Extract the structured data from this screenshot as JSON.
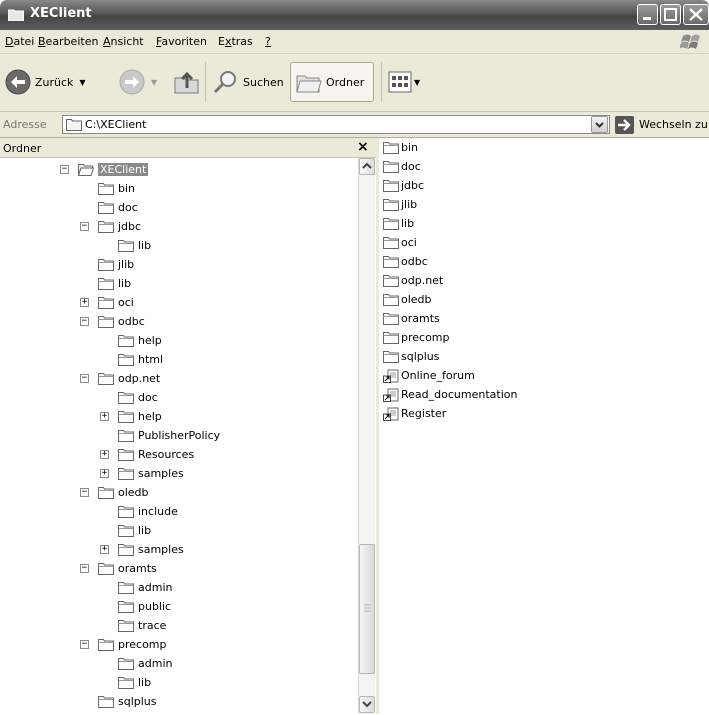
{
  "window": {
    "title": "XEClient"
  },
  "menu": [
    {
      "pre": "",
      "u": "D",
      "post": "atei",
      "name": "menu-datei"
    },
    {
      "pre": "",
      "u": "B",
      "post": "earbeiten",
      "name": "menu-bearbeiten"
    },
    {
      "pre": "",
      "u": "A",
      "post": "nsicht",
      "name": "menu-ansicht"
    },
    {
      "pre": "",
      "u": "F",
      "post": "avoriten",
      "name": "menu-favoriten"
    },
    {
      "pre": "E",
      "u": "x",
      "post": "tras",
      "name": "menu-extras"
    },
    {
      "pre": "",
      "u": "?",
      "post": "",
      "name": "menu-help"
    }
  ],
  "toolbar": {
    "back_label": "Zurück",
    "search_label": "Suchen",
    "folders_label": "Ordner"
  },
  "address": {
    "label": "Adresse",
    "path": "C:\\XEClient",
    "go_label": "Wechseln zu"
  },
  "folder_pane": {
    "title": "Ordner",
    "close": "×"
  },
  "tree": [
    {
      "label": "XEClient",
      "depth": 0,
      "expander": "minus",
      "selected": true
    },
    {
      "label": "bin",
      "depth": 1,
      "expander": "none"
    },
    {
      "label": "doc",
      "depth": 1,
      "expander": "none"
    },
    {
      "label": "jdbc",
      "depth": 1,
      "expander": "minus"
    },
    {
      "label": "lib",
      "depth": 2,
      "expander": "none"
    },
    {
      "label": "jlib",
      "depth": 1,
      "expander": "none"
    },
    {
      "label": "lib",
      "depth": 1,
      "expander": "none"
    },
    {
      "label": "oci",
      "depth": 1,
      "expander": "plus"
    },
    {
      "label": "odbc",
      "depth": 1,
      "expander": "minus"
    },
    {
      "label": "help",
      "depth": 2,
      "expander": "none"
    },
    {
      "label": "html",
      "depth": 2,
      "expander": "none"
    },
    {
      "label": "odp.net",
      "depth": 1,
      "expander": "minus"
    },
    {
      "label": "doc",
      "depth": 2,
      "expander": "none"
    },
    {
      "label": "help",
      "depth": 2,
      "expander": "plus"
    },
    {
      "label": "PublisherPolicy",
      "depth": 2,
      "expander": "none"
    },
    {
      "label": "Resources",
      "depth": 2,
      "expander": "plus"
    },
    {
      "label": "samples",
      "depth": 2,
      "expander": "plus"
    },
    {
      "label": "oledb",
      "depth": 1,
      "expander": "minus"
    },
    {
      "label": "include",
      "depth": 2,
      "expander": "none"
    },
    {
      "label": "lib",
      "depth": 2,
      "expander": "none"
    },
    {
      "label": "samples",
      "depth": 2,
      "expander": "plus"
    },
    {
      "label": "oramts",
      "depth": 1,
      "expander": "minus"
    },
    {
      "label": "admin",
      "depth": 2,
      "expander": "none"
    },
    {
      "label": "public",
      "depth": 2,
      "expander": "none"
    },
    {
      "label": "trace",
      "depth": 2,
      "expander": "none"
    },
    {
      "label": "precomp",
      "depth": 1,
      "expander": "minus"
    },
    {
      "label": "admin",
      "depth": 2,
      "expander": "none"
    },
    {
      "label": "lib",
      "depth": 2,
      "expander": "none"
    },
    {
      "label": "sqlplus",
      "depth": 1,
      "expander": "none"
    }
  ],
  "files": [
    {
      "label": "bin",
      "icon": "folder"
    },
    {
      "label": "doc",
      "icon": "folder"
    },
    {
      "label": "jdbc",
      "icon": "folder"
    },
    {
      "label": "jlib",
      "icon": "folder"
    },
    {
      "label": "lib",
      "icon": "folder"
    },
    {
      "label": "oci",
      "icon": "folder"
    },
    {
      "label": "odbc",
      "icon": "folder"
    },
    {
      "label": "odp.net",
      "icon": "folder"
    },
    {
      "label": "oledb",
      "icon": "folder"
    },
    {
      "label": "oramts",
      "icon": "folder"
    },
    {
      "label": "precomp",
      "icon": "folder"
    },
    {
      "label": "sqlplus",
      "icon": "folder"
    },
    {
      "label": "Online_forum",
      "icon": "shortcut"
    },
    {
      "label": "Read_documentation",
      "icon": "shortcut"
    },
    {
      "label": "Register",
      "icon": "shortcut"
    }
  ]
}
